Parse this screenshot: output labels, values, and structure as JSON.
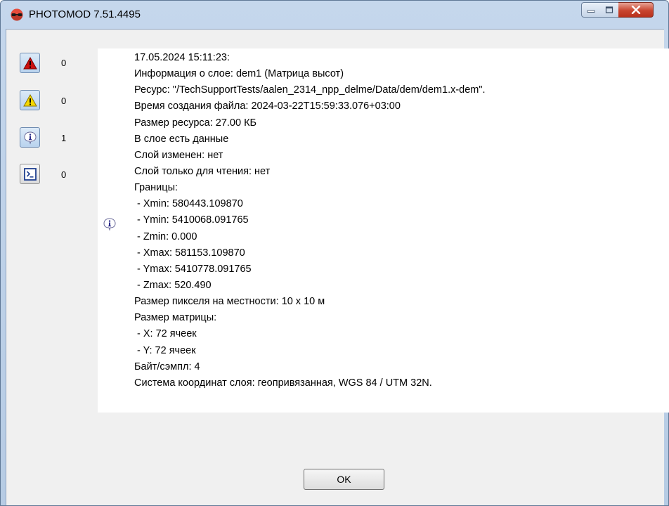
{
  "window": {
    "title": "PHOTOMOD 7.51.4495"
  },
  "sidebar": {
    "items": [
      {
        "icon": "error-icon",
        "count": "0"
      },
      {
        "icon": "warning-icon",
        "count": "0"
      },
      {
        "icon": "info-icon",
        "count": "1"
      },
      {
        "icon": "console-icon",
        "count": "0"
      }
    ]
  },
  "log": {
    "marker_icon": "info-icon",
    "lines": [
      "17.05.2024 15:11:23:",
      "Информация о слое: dem1 (Матрица высот)",
      "Ресурс: \"/TechSupportTests/aalen_2314_npp_delme/Data/dem/dem1.x-dem\".",
      "Время создания файла: 2024-03-22T15:59:33.076+03:00",
      "Размер ресурса: 27.00 КБ",
      "В слое есть данные",
      "Слой изменен: нет",
      "Слой только для чтения: нет",
      "Границы:",
      " - Xmin: 580443.109870",
      " - Ymin: 5410068.091765",
      " - Zmin: 0.000",
      " - Xmax: 581153.109870",
      " - Ymax: 5410778.091765",
      " - Zmax: 520.490",
      "Размер пикселя на местности: 10 x 10 м",
      "Размер матрицы:",
      " - X: 72 ячеек",
      " - Y: 72 ячеек",
      "Байт/сэмпл: 4",
      "Система координат слоя: геопривязанная, WGS 84 / UTM 32N."
    ]
  },
  "footer": {
    "ok_label": "OK"
  }
}
